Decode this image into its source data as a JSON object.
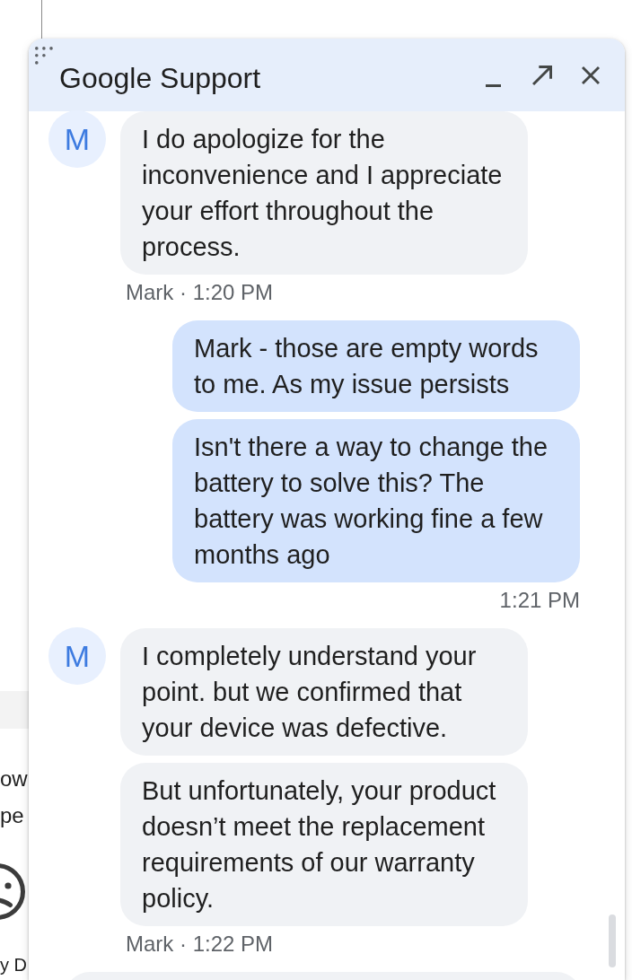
{
  "background_page": {
    "lines": [
      "ow",
      "pe"
    ],
    "caption": "y D"
  },
  "chat_window": {
    "title": "Google Support"
  },
  "messages": [
    {
      "kind": "agent",
      "avatar": "M",
      "bubbles": [
        "I do apologize for the inconvenience and I appreciate your effort throughout the process."
      ],
      "meta": "Mark · 1:20 PM"
    },
    {
      "kind": "user",
      "bubbles": [
        "Mark - those are empty words to me. As my issue persists",
        "Isn't there a way to change the battery to solve this? The battery was working fine a few months ago"
      ],
      "meta": "1:21 PM"
    },
    {
      "kind": "agent",
      "avatar": "M",
      "bubbles": [
        "I completely understand your point. but we confirmed that your device was defective.",
        "But unfortunately, your product doesn’t meet the replacement requirements of our warranty policy."
      ],
      "meta": "Mark · 1:22 PM"
    }
  ]
}
